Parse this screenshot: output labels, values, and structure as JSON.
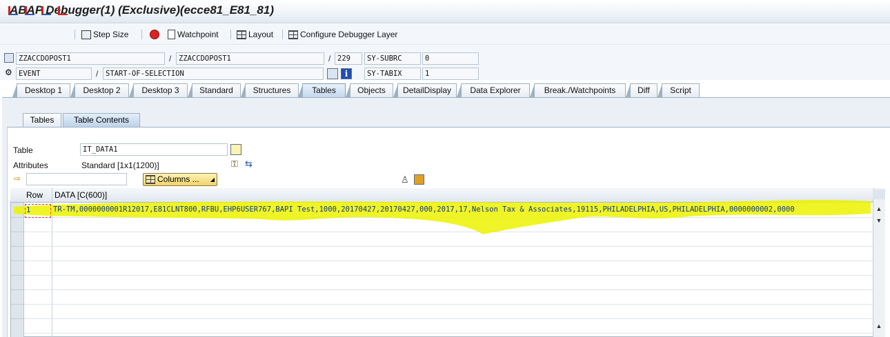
{
  "window": {
    "title": "ABAP Debugger(1)  (Exclusive)(ecce81_E81_81)"
  },
  "toolbar": {
    "step_icons": [
      "single-step-icon",
      "execute-icon",
      "return-icon",
      "continue-icon"
    ],
    "step_size_label": "Step Size",
    "watchpoint_label": "Watchpoint",
    "layout_label": "Layout",
    "configure_label": "Configure Debugger Layer"
  },
  "header": {
    "row1": {
      "program": "ZZACCDOPOST1",
      "include": "ZZACCDOPOST1",
      "line": "229",
      "sysvar_name": "SY-SUBRC",
      "sysvar_value": "0"
    },
    "row2": {
      "event_type": "EVENT",
      "event_name": "START-OF-SELECTION",
      "info_icon_text": "i",
      "sysvar_name": "SY-TABIX",
      "sysvar_value": "1"
    }
  },
  "tabs": [
    {
      "label": "Desktop 1"
    },
    {
      "label": "Desktop 2"
    },
    {
      "label": "Desktop 3"
    },
    {
      "label": "Standard"
    },
    {
      "label": "Structures"
    },
    {
      "label": "Tables"
    },
    {
      "label": "Objects"
    },
    {
      "label": "DetailDisplay"
    },
    {
      "label": "Data Explorer"
    },
    {
      "label": "Break./Watchpoints"
    },
    {
      "label": "Diff"
    },
    {
      "label": "Script"
    }
  ],
  "active_tab": "Tables",
  "subtabs": [
    {
      "label": "Tables"
    },
    {
      "label": "Table Contents"
    }
  ],
  "active_subtab": "Table Contents",
  "table_section": {
    "table_label": "Table",
    "table_value": "IT_DATA1",
    "attributes_label": "Attributes",
    "attributes_value": "Standard [1x1(1200)]",
    "filter_value": "",
    "columns_button_label": "Columns ..."
  },
  "grid": {
    "columns": [
      "Row",
      "DATA [C(600)]"
    ],
    "rows": [
      {
        "row": "1",
        "data": "TR-TM,0000000001R12017,E81CLNT800,RFBU,EHP6USER767,BAPI Test,1000,20170427,20170427,000,2017,17,Nelson Tax & Associates,19115,PHILADELPHIA,US,PHILADELPHIA,0000000002,0000"
      }
    ]
  },
  "colors": {
    "highlight": "#ecf200",
    "data_text": "#113a88",
    "accent": "#1f4fb4"
  }
}
